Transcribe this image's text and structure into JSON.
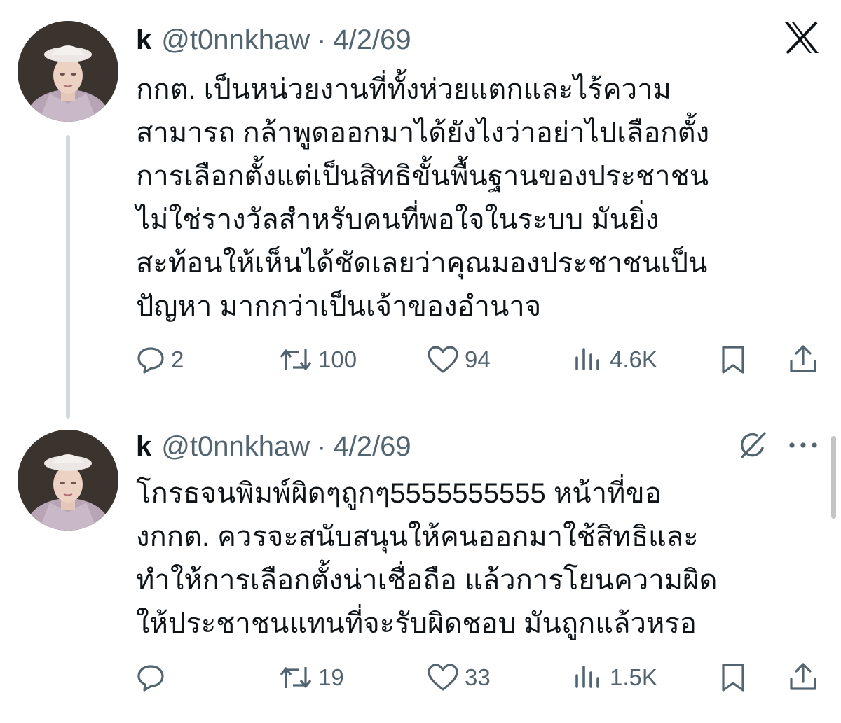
{
  "tweets": [
    {
      "name": "k",
      "handle": "@t0nnkhaw",
      "separator": "·",
      "date": "4/2/69",
      "text_lines": [
        "กกต. เป็นหน่วยงานที่ทั้งห่วยแตกและไร้ความ",
        "สามารถ กล้าพูดออกมาได้ยังไงว่าอย่าไปเลือกตั้ง",
        "การเลือกตั้งแต่เป็นสิทธิขั้นพื้นฐานของประชาชน",
        "ไม่ใช่รางวัลสำหรับคนที่พอใจในระบบ มันยิ่ง",
        "สะท้อนให้เห็นได้ชัดเลยว่าคุณมองประชาชนเป็น",
        "ปัญหา มากกว่าเป็นเจ้าของอำนาจ"
      ],
      "stats": {
        "replies": "2",
        "reposts": "100",
        "likes": "94",
        "views": "4.6K"
      },
      "icons": [
        "reply-icon",
        "repost-icon",
        "like-icon",
        "views-icon",
        "bookmark-icon",
        "share-icon"
      ]
    },
    {
      "name": "k",
      "handle": "@t0nnkhaw",
      "separator": "·",
      "date": "4/2/69",
      "text_lines": [
        "โกรธจนพิมพ์ผิดๆถูกๆ5555555555 หน้าที่ขอ",
        "งกกต. ควรจะสนับสนุนให้คนออกมาใช้สิทธิและ",
        "ทำให้การเลือกตั้งน่าเชื่อถือ แล้วการโยนความผิด",
        "ให้ประชาชนแทนที่จะรับผิดชอบ มันถูกแล้วหรอ"
      ],
      "stats": {
        "replies": "",
        "reposts": "19",
        "likes": "33",
        "views": "1.5K"
      },
      "icons": [
        "reply-icon",
        "repost-icon",
        "like-icon",
        "views-icon",
        "bookmark-icon",
        "share-icon"
      ]
    }
  ],
  "header_icons": [
    "x-logo-icon",
    "grok-icon",
    "more-icon"
  ],
  "colors": {
    "text": "#0f1419",
    "secondary": "#536471",
    "thread_line": "#cfd9de",
    "background": "#ffffff"
  }
}
